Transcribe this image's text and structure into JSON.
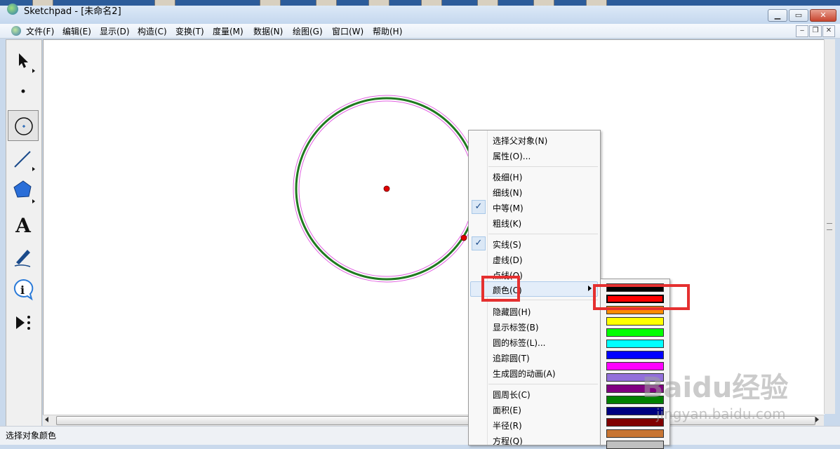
{
  "window": {
    "title": "Sketchpad  - [未命名2]",
    "minimize": "▁",
    "maximize": "▭",
    "close": "✕"
  },
  "menubar": {
    "items": [
      "文件(F)",
      "编辑(E)",
      "显示(D)",
      "构造(C)",
      "变换(T)",
      "度量(M)",
      "数据(N)",
      "绘图(G)",
      "窗口(W)",
      "帮助(H)"
    ],
    "mdi": [
      "‒",
      "❐",
      "✕"
    ]
  },
  "toolbox": {
    "tools": [
      "arrow-select-icon",
      "point-icon",
      "compass-icon",
      "straightedge-icon",
      "polygon-icon",
      "text-icon",
      "marker-icon",
      "information-icon",
      "custom-tool-icon"
    ],
    "active": "compass-icon",
    "text_tool_glyph": "A"
  },
  "canvas": {
    "circle_color": "#1f7a1f",
    "selection_color": "#e060e0",
    "point_color": "#e00000"
  },
  "context_menu": {
    "group1": [
      "选择父对象(N)",
      "属性(O)..."
    ],
    "group2": [
      "极细(H)",
      "细线(N)",
      "中等(M)",
      "粗线(K)"
    ],
    "group2_checked": "中等(M)",
    "group3": [
      "实线(S)",
      "虚线(D)",
      "点线(O)"
    ],
    "group3_checked": "实线(S)",
    "color_item": "颜色(C)",
    "group4": [
      "隐藏圆(H)",
      "显示标签(B)",
      "圆的标签(L)...",
      "追踪圆(T)",
      "生成圆的动画(A)"
    ],
    "group5": [
      "圆周长(C)",
      "面积(E)",
      "半径(R)",
      "方程(Q)"
    ],
    "check_glyph": "✓"
  },
  "palette": {
    "colors": [
      "#000000",
      "#ff0000",
      "#ff8c00",
      "#ffff00",
      "#00ff00",
      "#00ffff",
      "#0000ff",
      "#ff00ff",
      "#9370db",
      "#800080",
      "#008000",
      "#000080",
      "#800000",
      "#c87533",
      "#c0c0c0"
    ],
    "selected": "#ff0000"
  },
  "status": {
    "text": "选择对象颜色"
  },
  "watermark": {
    "brand": "Baidu经验",
    "url": "jingyan.baidu.com"
  }
}
